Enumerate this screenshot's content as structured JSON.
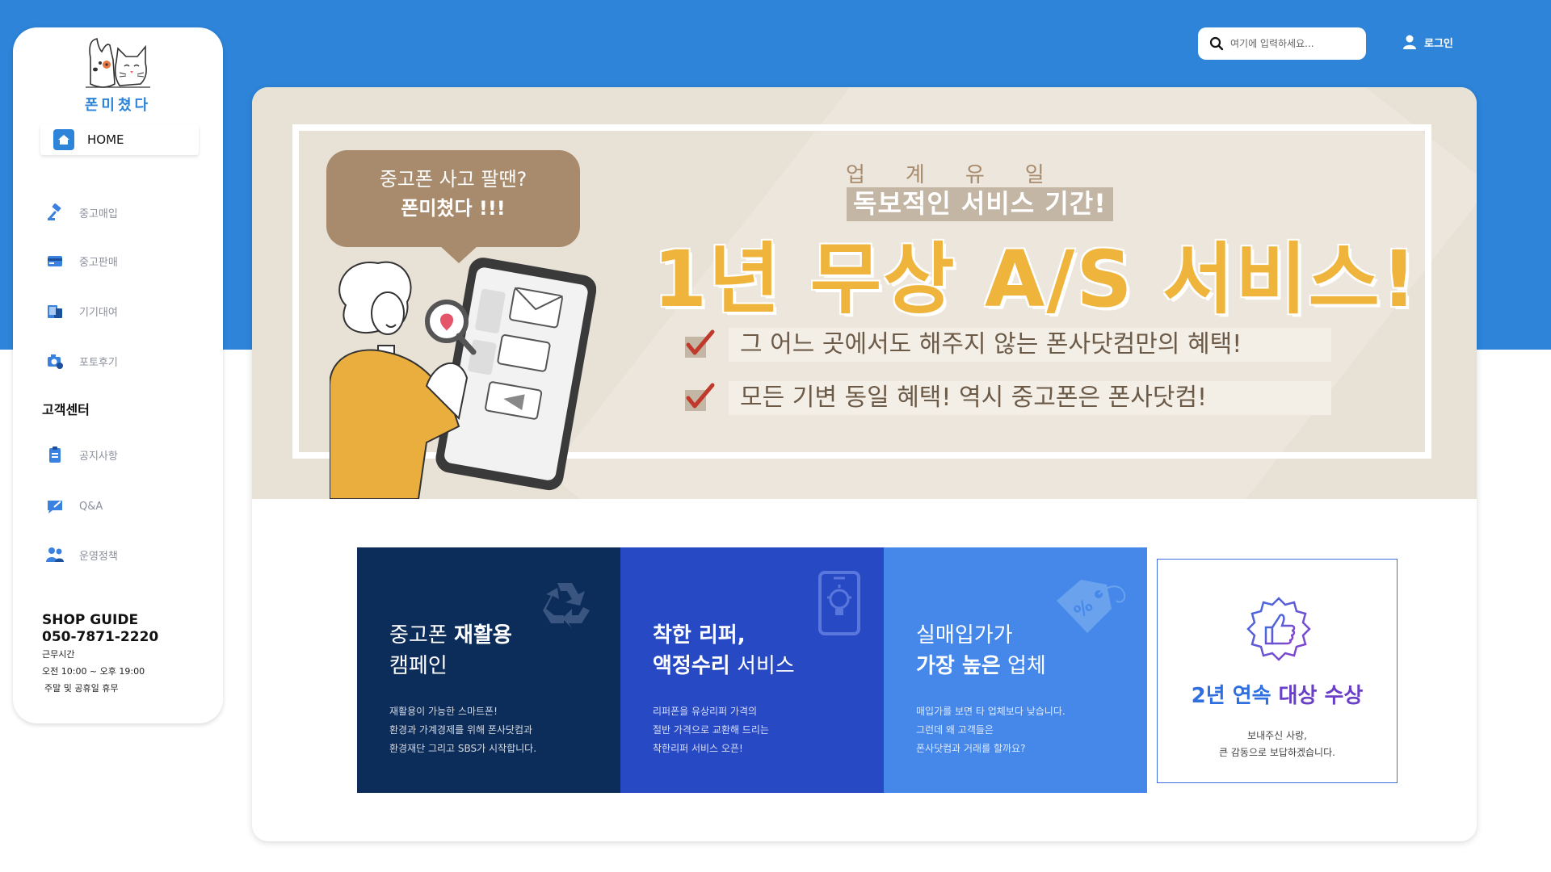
{
  "brand": {
    "name": "폰미쳤다"
  },
  "header": {
    "search_placeholder": "여기에 입력하세요...",
    "login_label": "로그인"
  },
  "sidebar": {
    "home_label": "HOME",
    "items": [
      {
        "label": "중고매입",
        "icon": "gavel-icon"
      },
      {
        "label": "중고판매",
        "icon": "card-icon"
      },
      {
        "label": "기기대여",
        "icon": "devices-icon"
      },
      {
        "label": "포토후기",
        "icon": "camera-icon"
      }
    ],
    "support_title": "고객센터",
    "support_items": [
      {
        "label": "공지사항",
        "icon": "clipboard-icon"
      },
      {
        "label": "Q&A",
        "icon": "chat-icon"
      },
      {
        "label": "운영정책",
        "icon": "users-icon"
      }
    ],
    "shop_guide": {
      "title": "SHOP GUIDE",
      "phone": "050-7871-2220",
      "hours_label": "근무시간",
      "hours": "오전 10:00 ~ 오후 19:00",
      "closed": "주말 및 공휴일 휴무"
    }
  },
  "banner": {
    "bubble_line1": "중고폰 사고 팔땐?",
    "bubble_line2": "폰미쳤다 !!!",
    "eyebrow": "업계유일",
    "subhead": "독보적인 서비스 기간!",
    "headline": "1년 무상 A/S 서비스!",
    "benefits": [
      "그 어느 곳에서도 해주지 않는 폰사닷컴만의 혜택!",
      "모든 기변 동일 혜택! 역시 중고폰은 폰사닷컴!"
    ],
    "colors": {
      "background": "#e8e1d6",
      "headline": "#efb43c",
      "bubble": "#a88a6c"
    }
  },
  "features": [
    {
      "title_prefix": "중고폰 ",
      "title_bold": "재활용",
      "title_line2": "캠페인",
      "desc": [
        "재활용이 가능한 스마트폰!",
        "환경과 가계경제를 위해 폰사닷컴과",
        "환경재단 그리고 SBS가 시작합니다."
      ],
      "icon": "recycle-icon",
      "color": "#0c2c5a"
    },
    {
      "title_bold": "착한 리퍼,",
      "title_line2_bold": "액정수리",
      "title_line2_rest": " 서비스",
      "desc": [
        "리퍼폰을 유상리퍼 가격의",
        "절반 가격으로 교환해 드리는",
        "착한리퍼 서비스 오픈!"
      ],
      "icon": "phone-bulb-icon",
      "color": "#2849c4"
    },
    {
      "title_prefix": "실매입가가",
      "title_line2_bold": "가장 높은",
      "title_line2_rest": " 업체",
      "desc": [
        "매입가를 보면 타 업체보다 낮습니다.",
        "그런데 왜 고객들은",
        "폰사닷컴과 거래를 할까요?"
      ],
      "icon": "price-tag-icon",
      "color": "#4588ea"
    }
  ],
  "award": {
    "title_prefix": "2년 연속 ",
    "title_accent": "대상 수상",
    "desc": [
      "보내주신 사랑,",
      "큰 감동으로 보답하겠습니다."
    ],
    "icon": "thumbs-up-badge-icon"
  }
}
